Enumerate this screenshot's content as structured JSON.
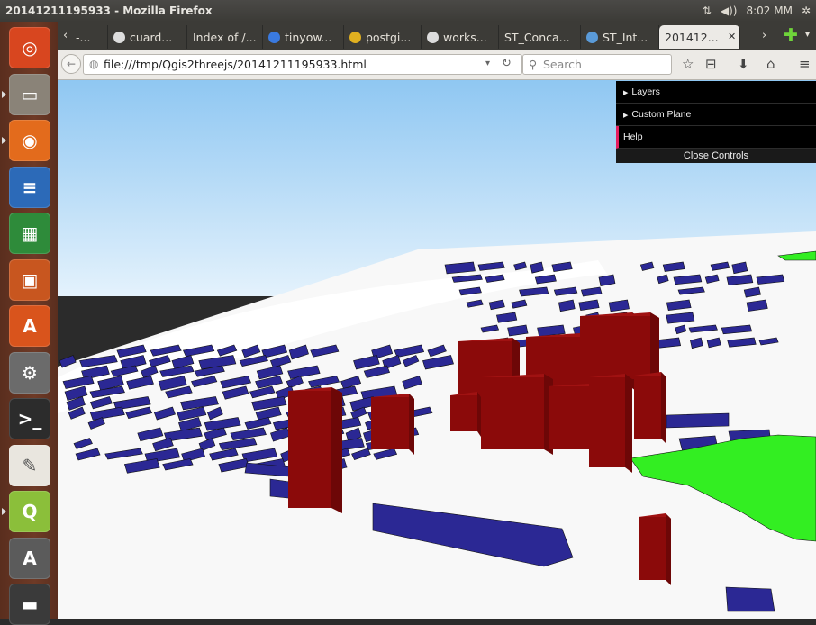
{
  "window": {
    "title": "20141211195933 - Mozilla Firefox",
    "clock": "8:02 MM"
  },
  "launcher": {
    "items": [
      {
        "name": "ubuntu-dash",
        "color": "#d8461f",
        "glyph": "◎"
      },
      {
        "name": "files",
        "color": "#8a8378",
        "glyph": "▭"
      },
      {
        "name": "firefox",
        "color": "#e36b1c",
        "glyph": "◉"
      },
      {
        "name": "writer",
        "color": "#2c6ab8",
        "glyph": "≡"
      },
      {
        "name": "calc",
        "color": "#2e8b3a",
        "glyph": "▦"
      },
      {
        "name": "impress",
        "color": "#c8561f",
        "glyph": "▣"
      },
      {
        "name": "software-center",
        "color": "#d9541c",
        "glyph": "A"
      },
      {
        "name": "system-settings",
        "color": "#6b6b6b",
        "glyph": "⚙"
      },
      {
        "name": "terminal",
        "color": "#2c2c2c",
        "glyph": ">_"
      },
      {
        "name": "text-editor",
        "color": "#e9e6df",
        "glyph": "✎"
      },
      {
        "name": "qgis",
        "color": "#8bbf3a",
        "glyph": "Q"
      },
      {
        "name": "update-manager",
        "color": "#5b5b5b",
        "glyph": "A"
      },
      {
        "name": "disk",
        "color": "#3a3a3a",
        "glyph": "▬"
      }
    ]
  },
  "tabs": [
    {
      "label": "-...",
      "icon": "none",
      "color": "#888"
    },
    {
      "label": "cuard...",
      "icon": "github",
      "color": "#ddd"
    },
    {
      "label": "Index of /...",
      "icon": "none",
      "color": "#888"
    },
    {
      "label": "tinyow...",
      "icon": "google",
      "color": "#3a7ae0"
    },
    {
      "label": "postgi...",
      "icon": "chrome",
      "color": "#e0b020"
    },
    {
      "label": "works...",
      "icon": "github",
      "color": "#ddd"
    },
    {
      "label": "ST_Conca...",
      "icon": "none",
      "color": "#888"
    },
    {
      "label": "ST_Int...",
      "icon": "globe",
      "color": "#5a9ad8"
    },
    {
      "label": "201412...",
      "icon": "none",
      "color": "#888"
    }
  ],
  "navbar": {
    "url": "file:///tmp/Qgis2threejs/20141211195933.html",
    "search_placeholder": "Search"
  },
  "controls": {
    "layers": "Layers",
    "custom_plane": "Custom Plane",
    "help": "Help",
    "close": "Close Controls"
  },
  "scene_colors": {
    "sky_top": "#8fc7f2",
    "sky_bottom": "#e4f2fc",
    "ground": "#f8f8f8",
    "building_flat": "#2b2894",
    "building_tall": "#8b0a0a",
    "park": "#33ee22"
  }
}
